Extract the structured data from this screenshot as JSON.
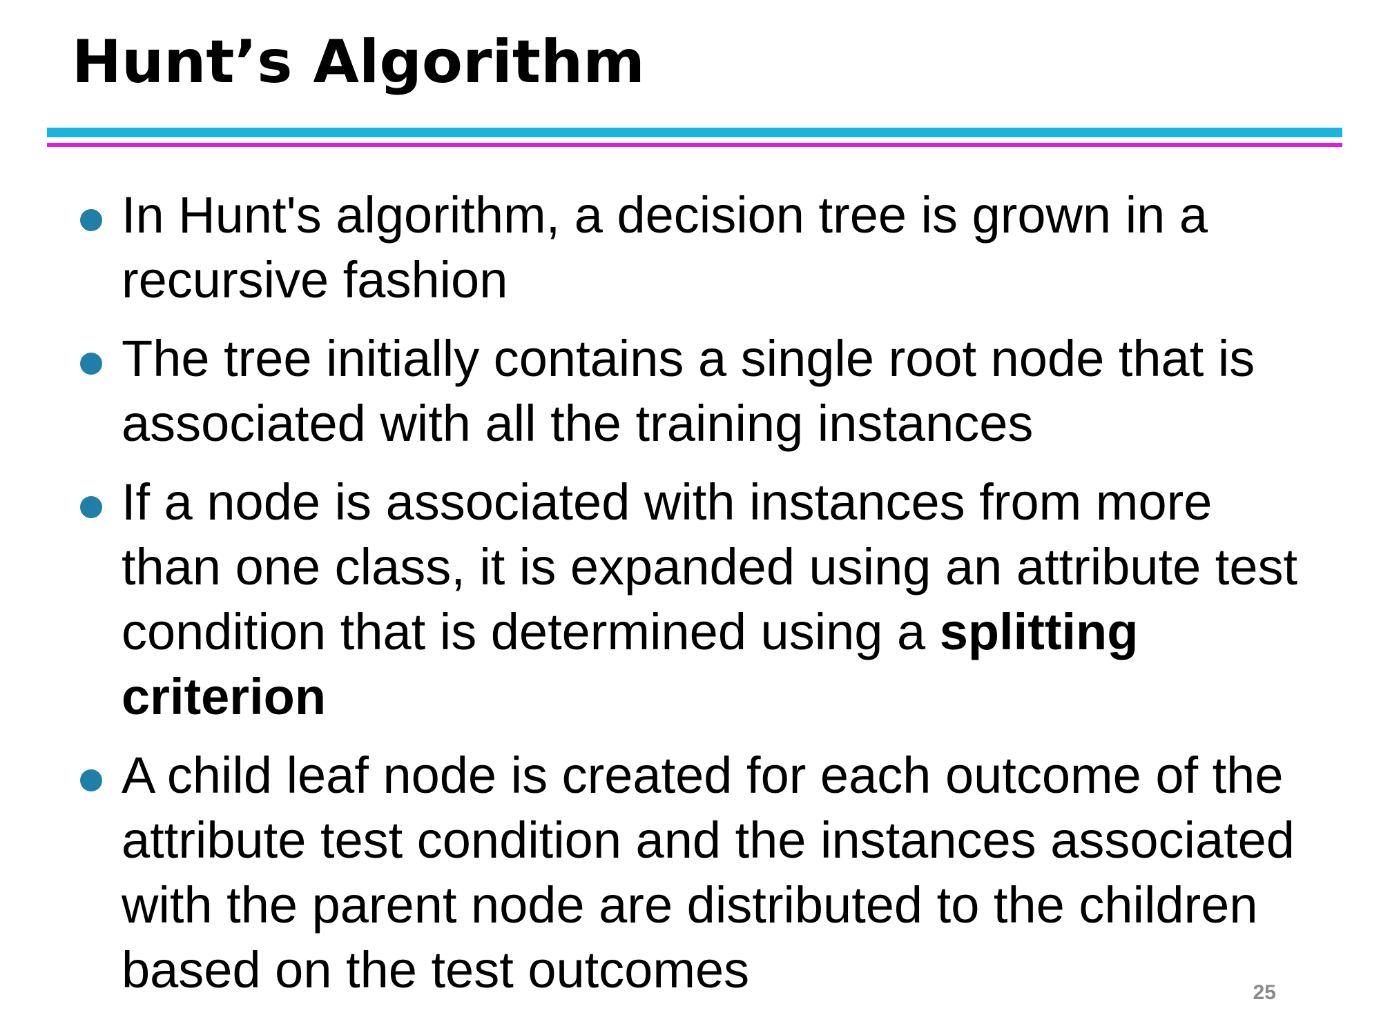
{
  "slide": {
    "title": "Hunt’s Algorithm",
    "bullets": [
      {
        "text": "In Hunt's algorithm, a decision tree is grown in a recursive fashion"
      },
      {
        "text": "The tree initially contains a single root node that is associated with all the training instances"
      },
      {
        "text": "If a node is associated with instances from more than one class, it is expanded using an attribute test condition that is determined using a ",
        "bold": "splitting criterion"
      },
      {
        "text": "A child leaf node is created for each outcome of the attribute test condition and the instances associated with the parent node are distributed to the children based on the test outcomes"
      }
    ],
    "page_number": "25"
  },
  "colors": {
    "rule_top": "#19b5df",
    "rule_bottom": "#e21be2",
    "bullet": "#1f7fa6",
    "page_number": "#8a8a8a"
  }
}
